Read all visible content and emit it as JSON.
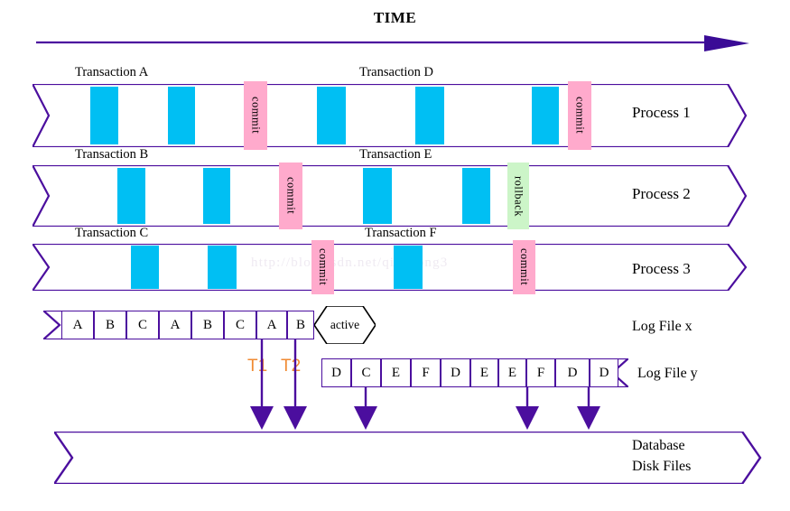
{
  "diagram": {
    "title": "TIME",
    "watermark": "http://blog.csdn.net/qingsong3",
    "colors": {
      "outline": "#4b0e9e",
      "operation_bar": "#00bff3",
      "commit": "#ffaacc",
      "rollback": "#ccf5c8",
      "arrow": "#4b0e9e",
      "t_label": "#f08a33"
    },
    "processes": [
      {
        "name": "Process 1",
        "transactions": [
          "Transaction A",
          "Transaction D"
        ],
        "operations": [
          {
            "type": "work"
          },
          {
            "type": "work"
          },
          {
            "type": "commit",
            "label": "commit"
          },
          {
            "type": "work"
          },
          {
            "type": "work"
          },
          {
            "type": "work"
          },
          {
            "type": "commit",
            "label": "commit"
          }
        ]
      },
      {
        "name": "Process 2",
        "transactions": [
          "Transaction B",
          "Transaction E"
        ],
        "operations": [
          {
            "type": "work"
          },
          {
            "type": "work"
          },
          {
            "type": "commit",
            "label": "commit"
          },
          {
            "type": "work"
          },
          {
            "type": "work"
          },
          {
            "type": "rollback",
            "label": "rollback"
          }
        ]
      },
      {
        "name": "Process 3",
        "transactions": [
          "Transaction C",
          "Transaction F"
        ],
        "operations": [
          {
            "type": "work"
          },
          {
            "type": "work"
          },
          {
            "type": "commit",
            "label": "commit"
          },
          {
            "type": "work"
          },
          {
            "type": "commit",
            "label": "commit"
          }
        ]
      }
    ],
    "log_file_x": {
      "label": "Log File x",
      "cells": [
        "A",
        "B",
        "C",
        "A",
        "B",
        "C",
        "A",
        "B"
      ],
      "status_badge": "active"
    },
    "log_file_y": {
      "label": "Log File y",
      "cells": [
        "D",
        "C",
        "E",
        "F",
        "D",
        "E",
        "E",
        "F",
        "D",
        "D"
      ]
    },
    "checkpoint_labels": [
      "T1",
      "T2"
    ],
    "database": {
      "line1": "Database",
      "line2": "Disk Files"
    }
  }
}
